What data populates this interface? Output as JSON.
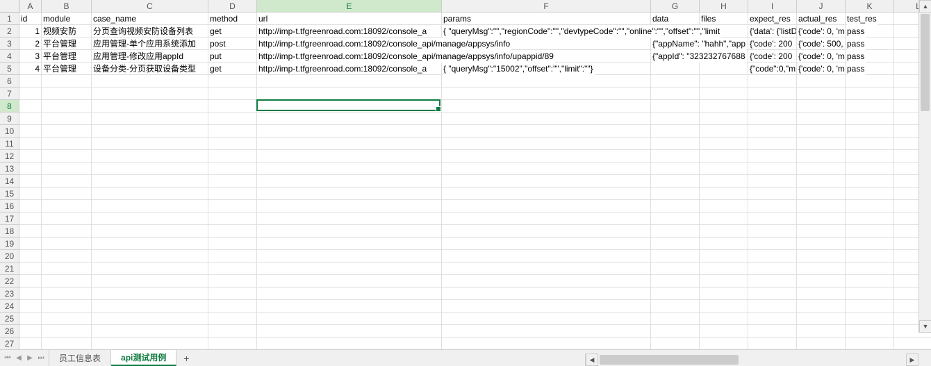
{
  "columns": [
    "A",
    "B",
    "C",
    "D",
    "E",
    "F",
    "G",
    "H",
    "I",
    "J",
    "K",
    "L"
  ],
  "rowCount": 27,
  "selectedCell": "E8",
  "selectedColIndex": 4,
  "selectedRowIndex": 7,
  "headers": {
    "A": "id",
    "B": "module",
    "C": "case_name",
    "D": "method",
    "E": "url",
    "F": "params",
    "G": "data",
    "H": "files",
    "I": "expect_res",
    "J": "actual_res",
    "K": "test_res"
  },
  "rows": [
    {
      "A": "1",
      "B": "视频安防",
      "C": "分页查询视频安防设备列表",
      "D": "get",
      "E": "http://imp-t.tfgreenroad.com:18092/console_a",
      "F": "{ \"queryMsg\":\"\",\"regionCode\":\"\",\"devtypeCode\":\"\",\"online\":\"\",\"offset\":\"\",\"limit",
      "G": "",
      "H": "",
      "I": "{'data': {'listD",
      "J": "{'code': 0, 'm",
      "K": "pass"
    },
    {
      "A": "2",
      "B": "平台管理",
      "C": "应用管理-单个应用系统添加",
      "D": "post",
      "E": "http://imp-t.tfgreenroad.com:18092/console_api/manage/appsys/info",
      "F": "",
      "G": "{\"appName\": \"hahh\",\"app",
      "H": "",
      "I": "{'code': 200",
      "J": "{'code': 500,",
      "K": "pass"
    },
    {
      "A": "3",
      "B": "平台管理",
      "C": "应用管理-修改应用appId",
      "D": "put",
      "E": "http://imp-t.tfgreenroad.com:18092/console_api/manage/appsys/info/upappid/89",
      "F": "",
      "G": "{\"appId\": \"323232767688",
      "H": "",
      "I": "{'code': 200",
      "J": "{'code': 0, 'm",
      "K": "pass"
    },
    {
      "A": "4",
      "B": "平台管理",
      "C": "设备分类-分页获取设备类型",
      "D": "get",
      "E": "http://imp-t.tfgreenroad.com:18092/console_a",
      "F": "{ \"queryMsg\":\"15002\",\"offset\":\"\",\"limit\":\"\"}",
      "G": "",
      "H": "",
      "I": "{\"code\":0,\"m",
      "J": "{'code': 0, 'm",
      "K": "pass"
    }
  ],
  "tabs": [
    {
      "name": "员工信息表",
      "active": false
    },
    {
      "name": "api测试用例",
      "active": true
    }
  ],
  "addSheetLabel": "+"
}
